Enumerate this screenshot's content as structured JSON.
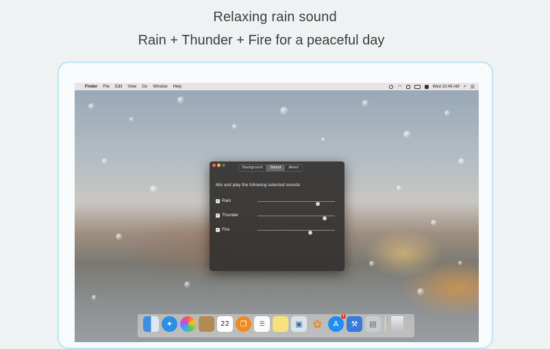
{
  "promo": {
    "title": "Relaxing rain sound",
    "subtitle": "Rain + Thunder + Fire for a peaceful day"
  },
  "menubar": {
    "apple_glyph": "",
    "items": [
      "Finder",
      "File",
      "Edit",
      "View",
      "Go",
      "Window",
      "Help"
    ],
    "clock": "Wed 10:49 AM"
  },
  "window": {
    "tabs": [
      {
        "label": "Background",
        "active": false
      },
      {
        "label": "Sound",
        "active": true
      },
      {
        "label": "About",
        "active": false
      }
    ],
    "description": "Mix and play the following selected sounds",
    "sounds": [
      {
        "label": "Rain",
        "checked": true,
        "volume": 0.78
      },
      {
        "label": "Thunder",
        "checked": true,
        "volume": 0.87
      },
      {
        "label": "Fire",
        "checked": true,
        "volume": 0.68
      }
    ]
  },
  "dock": {
    "calendar_day": "22",
    "app_store_badge": "1",
    "apps": [
      "finder-icon",
      "safari-icon",
      "photos-icon",
      "contacts-icon",
      "calendar-icon",
      "ibooks-icon",
      "reminders-icon",
      "notes-icon",
      "preview-icon",
      "lotus-icon",
      "app-store-icon",
      "xcode-icon",
      "image-capture-icon",
      "trash-icon"
    ]
  },
  "colors": {
    "frame_border": "#bfe3f2",
    "window_bg": "#343230",
    "active_tab": "#6a6866"
  }
}
